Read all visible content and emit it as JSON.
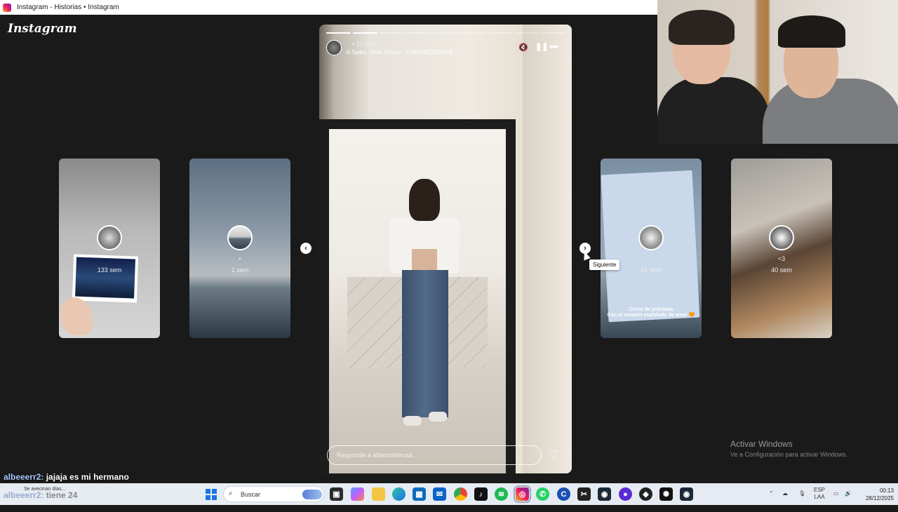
{
  "window": {
    "title": "Instagram - Historias • Instagram"
  },
  "app": {
    "logo": "Instagram"
  },
  "previews": [
    {
      "age": "133 sem"
    },
    {
      "name": "•",
      "age": "1 sem"
    },
    {
      "age": "61 sem",
      "caption": "Cierre de prácticas\nCon el corazón explotado de amor 🧡"
    },
    {
      "name": "<3",
      "age": "40 sem"
    }
  ],
  "story": {
    "time": "12 sem",
    "music": "Saiko, Omar Courtz · LOKENECESITAS",
    "progress_total": 9,
    "progress_done": 2,
    "reply_placeholder": "Responde a albercisternaa..."
  },
  "tooltip": {
    "next": "Siguiente"
  },
  "icons": {
    "prev": "chevron-left-icon",
    "next": "chevron-right-icon",
    "mute": "speaker-muted-icon",
    "pause": "pause-icon",
    "more": "more-horizontal-icon",
    "heart": "heart-icon"
  },
  "watermark": {
    "line1": "Activar Windows",
    "line2": "Ve a Configuración para activar Windows."
  },
  "chat": {
    "user": "albeeerr2:",
    "message": "jajaja es mi hermano"
  },
  "taskbar": {
    "notification": "Se avecinan días...",
    "overlay_user": "albeeerr2:",
    "overlay_text": "tiene 24",
    "search_label": "Buscar",
    "language": "ESP",
    "layout": "LAA",
    "time": "00:13",
    "date": "28/12/2025"
  }
}
